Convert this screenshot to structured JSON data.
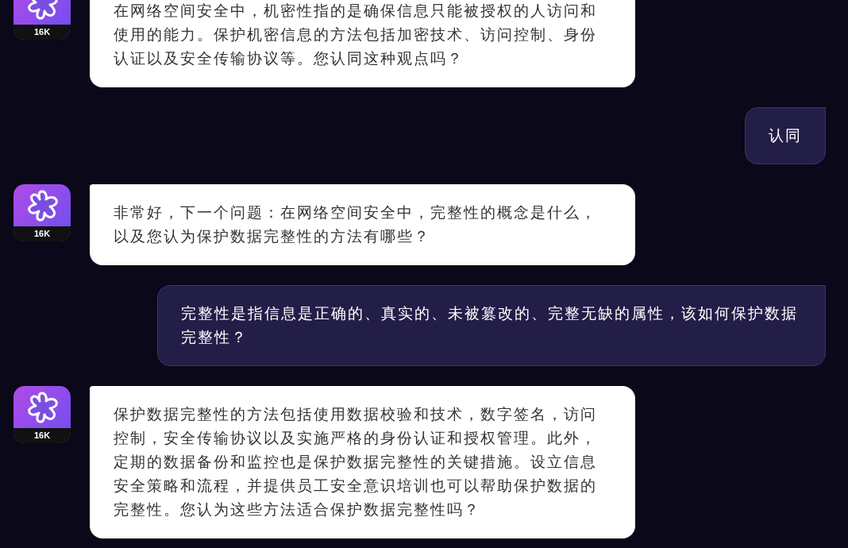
{
  "messages": [
    {
      "kind": "bot",
      "badge": "16K",
      "text": "在网络空间安全中，机密性指的是确保信息只能被授权的人访问和使用的能力。保护机密信息的方法包括加密技术、访问控制、身份认证以及安全传输协议等。您认同这种观点吗？"
    },
    {
      "kind": "user",
      "text": "认同"
    },
    {
      "kind": "bot",
      "badge": "16K",
      "text": "非常好，下一个问题：在网络空间安全中，完整性的概念是什么，以及您认为保护数据完整性的方法有哪些？"
    },
    {
      "kind": "user",
      "text": "完整性是指信息是正确的、真实的、未被篡改的、完整无缺的属性，该如何保护数据完整性？"
    },
    {
      "kind": "bot",
      "badge": "16K",
      "text": "保护数据完整性的方法包括使用数据校验和技术，数字签名，访问控制，安全传输协议以及实施严格的身份认证和授权管理。此外，定期的数据备份和监控也是保护数据完整性的关键措施。设立信息安全策略和流程，并提供员工安全意识培训也可以帮助保护数据的完整性。您认为这些方法适合保护数据完整性吗？"
    }
  ]
}
